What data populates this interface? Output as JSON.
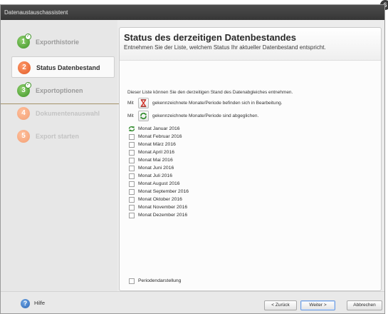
{
  "window": {
    "title": "Datenaustauschassistent"
  },
  "sidebar": {
    "steps": [
      {
        "number": "1",
        "label": "Exporthistorie",
        "state": "done"
      },
      {
        "number": "2",
        "label": "Status Datenbestand",
        "state": "current"
      },
      {
        "number": "3",
        "label": "Exportoptionen",
        "state": "done"
      },
      {
        "number": "4",
        "label": "Dokumentenauswahl",
        "state": "todo"
      },
      {
        "number": "5",
        "label": "Export starten",
        "state": "todo"
      }
    ]
  },
  "main": {
    "title": "Status des derzeitigen Datenbestandes",
    "subtitle": "Entnehmen Sie der Liste, welchem Status Ihr aktueller Datenbestand entspricht.",
    "intro": "Dieser Liste können Sie den derzeitigen Stand des Datenabgleiches entnehmen.",
    "legend": {
      "prefix": "Mit",
      "in_progress_text": "gekennzeichnete Monate/Periode befinden sich in Bearbeitung.",
      "synced_text": "gekennzeichnete Monate/Periode sind abgeglichen."
    },
    "months": [
      {
        "label": "Monat Januar 2016",
        "status": "synced"
      },
      {
        "label": "Monat Februar 2016",
        "status": "none"
      },
      {
        "label": "Monat März 2016",
        "status": "none"
      },
      {
        "label": "Monat April 2016",
        "status": "none"
      },
      {
        "label": "Monat Mai 2016",
        "status": "none"
      },
      {
        "label": "Monat Juni 2016",
        "status": "none"
      },
      {
        "label": "Monat Juli 2016",
        "status": "none"
      },
      {
        "label": "Monat August 2016",
        "status": "none"
      },
      {
        "label": "Monat September 2016",
        "status": "none"
      },
      {
        "label": "Monat Oktober 2016",
        "status": "none"
      },
      {
        "label": "Monat November 2016",
        "status": "none"
      },
      {
        "label": "Monat Dezember 2016",
        "status": "none"
      }
    ],
    "period_view_label": "Periodendarstellung"
  },
  "footer": {
    "help_label": "Hilfe",
    "back_label": "< Zurück",
    "next_label": "Weiter >",
    "cancel_label": "Abbrechen"
  },
  "icons": {
    "in_progress": "hourglass-icon",
    "synced": "sync-arrow-icon",
    "help": "help-icon"
  },
  "colors": {
    "done": "#3f9427",
    "current": "#e05a26",
    "todo": "#f39f73",
    "in_progress_icon": "#d42a1f",
    "synced_icon": "#2f8a2a"
  }
}
